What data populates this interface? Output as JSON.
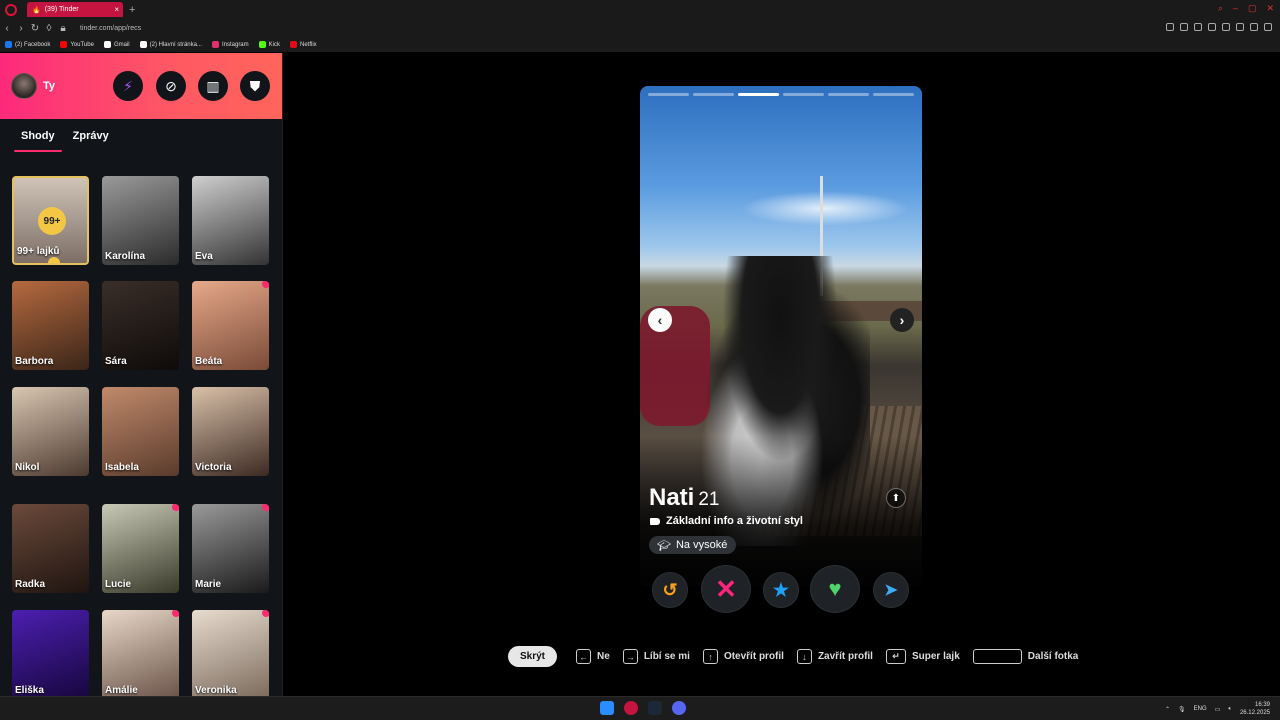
{
  "browser": {
    "tab_title": "(39) Tinder",
    "tab_close": "×",
    "newtab": "+",
    "url": "tinder.com/app/recs",
    "bookmarks": [
      {
        "label": "(2) Facebook",
        "color": "#1877f2"
      },
      {
        "label": "YouTube",
        "color": "#ff0000"
      },
      {
        "label": "Gmail",
        "color": "#ffffff"
      },
      {
        "label": "(2) Hlavní stránka...",
        "color": "#ffffff"
      },
      {
        "label": "Instagram",
        "color": "#e1306c"
      },
      {
        "label": "Kick",
        "color": "#53fc18"
      },
      {
        "label": "Netflix",
        "color": "#e50914"
      }
    ]
  },
  "sidebar": {
    "user_name": "Ty",
    "tabs": [
      "Shody",
      "Zprávy"
    ],
    "likes_count": "99+",
    "likes_label": "99+ lajků",
    "matches": [
      {
        "name": "Karolína",
        "dot": false
      },
      {
        "name": "Eva",
        "dot": false
      },
      {
        "name": "Barbora",
        "dot": false
      },
      {
        "name": "Sára",
        "dot": false
      },
      {
        "name": "Beáta",
        "dot": true
      },
      {
        "name": "Nikol",
        "dot": false
      },
      {
        "name": "Isabela",
        "dot": false
      },
      {
        "name": "Victoria",
        "dot": false
      },
      {
        "name": "Radka",
        "dot": false
      },
      {
        "name": "Lucie",
        "dot": true
      },
      {
        "name": "Marie",
        "dot": true
      },
      {
        "name": "Eliška",
        "dot": false
      },
      {
        "name": "Amálie",
        "dot": true
      },
      {
        "name": "Veronika",
        "dot": true
      }
    ]
  },
  "profile": {
    "name": "Nati",
    "age": "21",
    "photo_count": 6,
    "active_photo": 3,
    "basic_info": "Základní info a životní styl",
    "chip": "Na vysoké"
  },
  "shortcuts": {
    "hide": "Skrýt",
    "items": [
      {
        "key": "←",
        "label": "Ne"
      },
      {
        "key": "→",
        "label": "Líbí se mi"
      },
      {
        "key": "↑",
        "label": "Otevřít profil"
      },
      {
        "key": "↓",
        "label": "Zavřít profil"
      },
      {
        "key": "↵",
        "label": "Super lajk"
      },
      {
        "key": "",
        "label": "Další fotka"
      }
    ]
  },
  "taskbar": {
    "lang": "ENG",
    "time": "16:39",
    "date": "26.12.2025"
  },
  "colors": {
    "brand_gradient_start": "#fd297b",
    "brand_gradient_end": "#ff655b",
    "nope": "#fd267d",
    "like": "#4fd36a",
    "superlike": "#1ea1f7",
    "rewind": "#f7a21b"
  }
}
